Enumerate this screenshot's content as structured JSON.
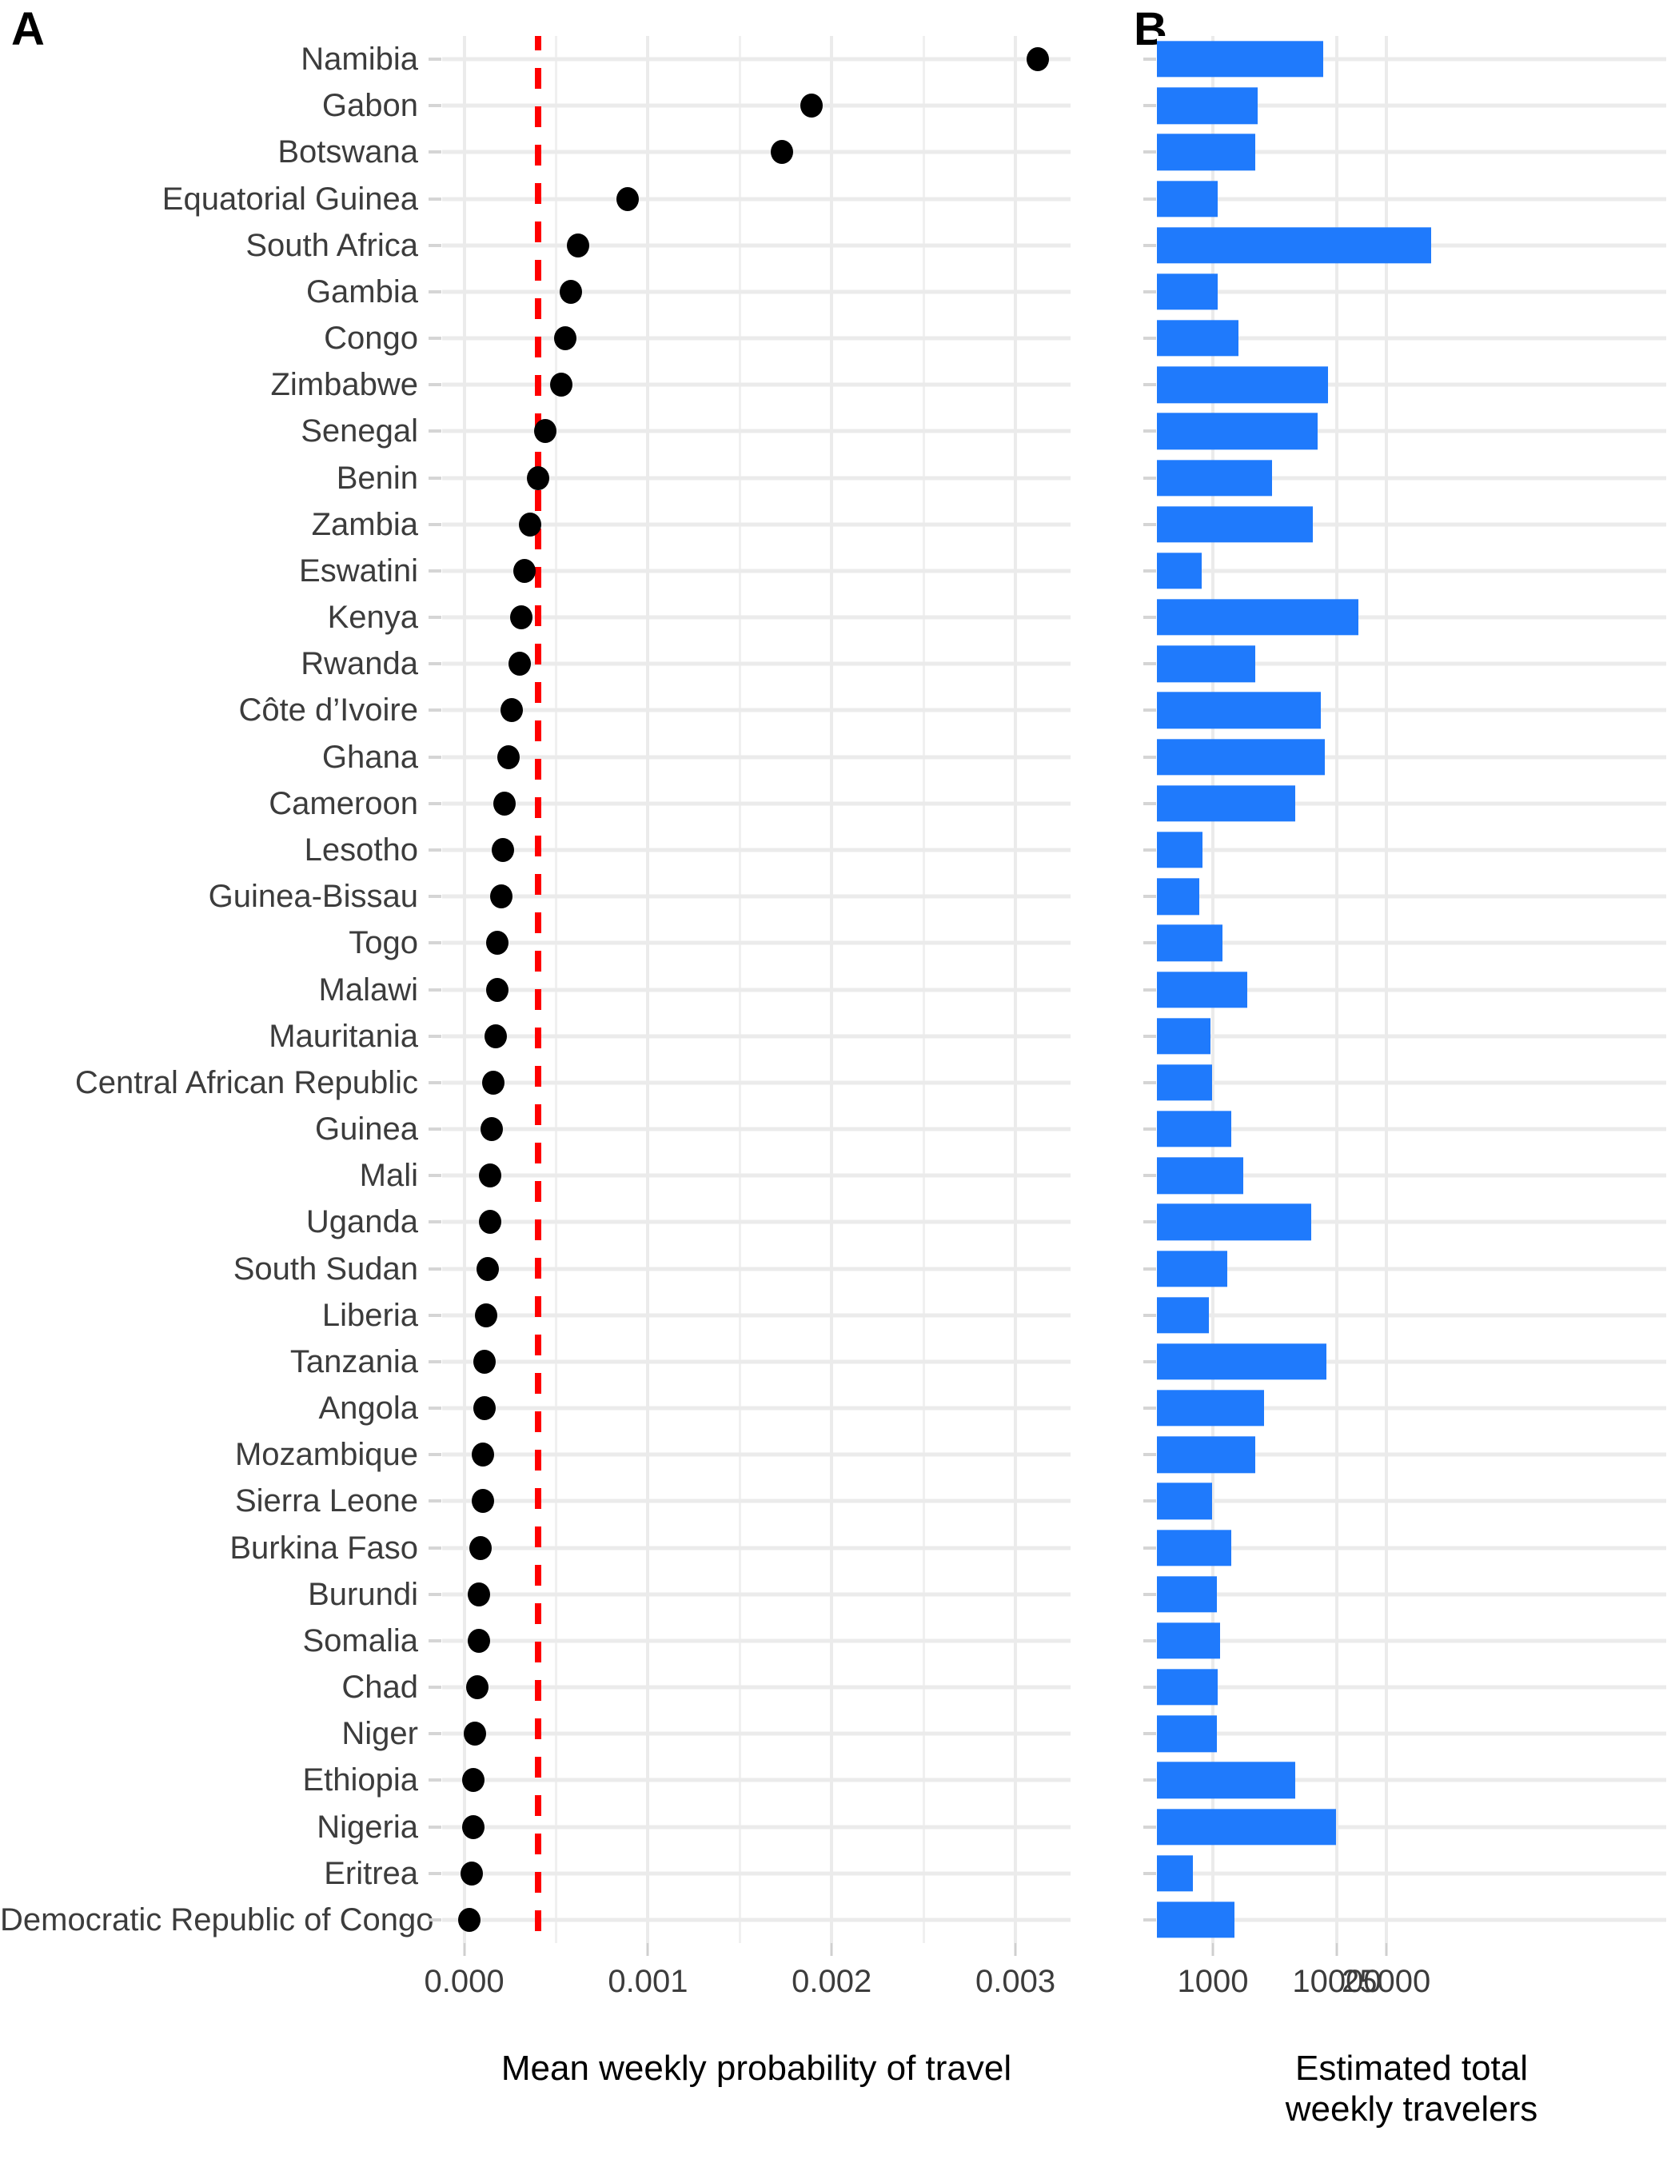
{
  "panels": {
    "a_tag": "A",
    "b_tag": "B"
  },
  "axis_titles": {
    "a": "Mean weekly probability of travel",
    "b": "Estimated total\nweekly travelers"
  },
  "chart_data": {
    "type": "bar",
    "title": "",
    "layout": "two-panel horizontal: A = dot plot of mean weekly probability of travel, B = bar chart of estimated total weekly travelers (log scale)",
    "categories": [
      "Namibia",
      "Gabon",
      "Botswana",
      "Equatorial Guinea",
      "South Africa",
      "Gambia",
      "Congo",
      "Zimbabwe",
      "Senegal",
      "Benin",
      "Zambia",
      "Eswatini",
      "Kenya",
      "Rwanda",
      "Côte d’Ivoire",
      "Ghana",
      "Cameroon",
      "Lesotho",
      "Guinea-Bissau",
      "Togo",
      "Malawi",
      "Mauritania",
      "Central African Republic",
      "Guinea",
      "Mali",
      "Uganda",
      "South Sudan",
      "Liberia",
      "Tanzania",
      "Angola",
      "Mozambique",
      "Sierra Leone",
      "Burkina Faso",
      "Burundi",
      "Somalia",
      "Chad",
      "Niger",
      "Ethiopia",
      "Nigeria",
      "Eritrea",
      "Democratic Republic of Congo"
    ],
    "panel_a": {
      "type": "scatter",
      "xlabel": "Mean weekly probability of travel",
      "xlim": [
        -0.00012,
        0.0033
      ],
      "xticks": [
        0.0,
        0.001,
        0.002,
        0.003
      ],
      "xtick_labels": [
        "0.000",
        "0.001",
        "0.002",
        "0.003"
      ],
      "minor_gridlines": [
        0.0005,
        0.0015,
        0.0025
      ],
      "grid": true,
      "marker": "filled-circle-black",
      "threshold_line": {
        "value": 0.0004,
        "style": "dashed",
        "color": "#ff0000"
      },
      "values": [
        0.00312,
        0.00189,
        0.00173,
        0.00089,
        0.00062,
        0.00058,
        0.00055,
        0.00053,
        0.00044,
        0.0004,
        0.00036,
        0.00033,
        0.00031,
        0.0003,
        0.00026,
        0.00024,
        0.00022,
        0.00021,
        0.0002,
        0.00018,
        0.00018,
        0.00017,
        0.00016,
        0.00015,
        0.00014,
        0.00014,
        0.00013,
        0.00012,
        0.00011,
        0.00011,
        0.0001,
        0.0001,
        9e-05,
        8e-05,
        8e-05,
        7e-05,
        6e-05,
        5e-05,
        5e-05,
        4e-05,
        3e-05
      ]
    },
    "panel_b": {
      "type": "bar",
      "xlabel": "Estimated total weekly travelers",
      "xscale": "log",
      "xticks": [
        1000,
        10000,
        25000
      ],
      "xtick_labels": [
        "1000",
        "10000",
        "25000"
      ],
      "grid": true,
      "bar_color": "#1f7afc",
      "values": [
        7800,
        2300,
        2200,
        1100,
        58000,
        1100,
        1600,
        8500,
        7000,
        3000,
        6400,
        810,
        15000,
        2200,
        7400,
        8000,
        4600,
        830,
        780,
        1200,
        1900,
        950,
        980,
        1400,
        1750,
        6200,
        1300,
        930,
        8200,
        2600,
        2200,
        980,
        1400,
        1080,
        1150,
        1100,
        1080,
        4600,
        9800,
        690,
        1500
      ]
    }
  }
}
